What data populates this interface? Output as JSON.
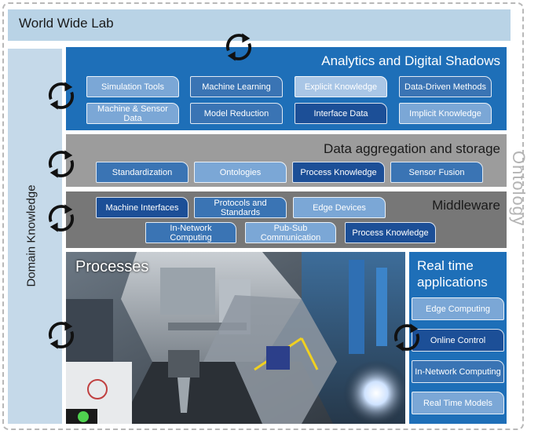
{
  "world_wide_lab": "World Wide Lab",
  "domain_knowledge": "Domain Knowledge",
  "ontology": "Ontology",
  "analytics": {
    "title": "Analytics and Digital Shadows",
    "items": [
      "Simulation Tools",
      "Machine Learning",
      "Explicit Knowledge",
      "Data-Driven Methods",
      "Machine & Sensor Data",
      "Model Reduction",
      "Interface Data",
      "Implicit Knowledge"
    ]
  },
  "data_layer": {
    "title": "Data aggregation and storage",
    "items": [
      "Standardization",
      "Ontologies",
      "Process Knowledge",
      "Sensor Fusion"
    ]
  },
  "middleware": {
    "title": "Middleware",
    "items": [
      "Machine Interfaces",
      "Protocols and Standards",
      "Edge Devices",
      "In-Network Computing",
      "Pub-Sub Communication",
      "Process Knowledge"
    ]
  },
  "processes": {
    "title": "Processes"
  },
  "realtime": {
    "title_line1": "Real time",
    "title_line2": "applications",
    "items": [
      "Edge Computing",
      "Online Control",
      "In-Network Computing",
      "Real Time Models"
    ]
  },
  "colors": {
    "analytics_blue": "#1e6fb8",
    "band_light_blue": "#b9d3e6",
    "data_gray": "#9c9c9c",
    "middleware_gray": "#777777",
    "ontology_gray": "#b4b4b4"
  },
  "icons": [
    "cycle-arrows-icon"
  ]
}
